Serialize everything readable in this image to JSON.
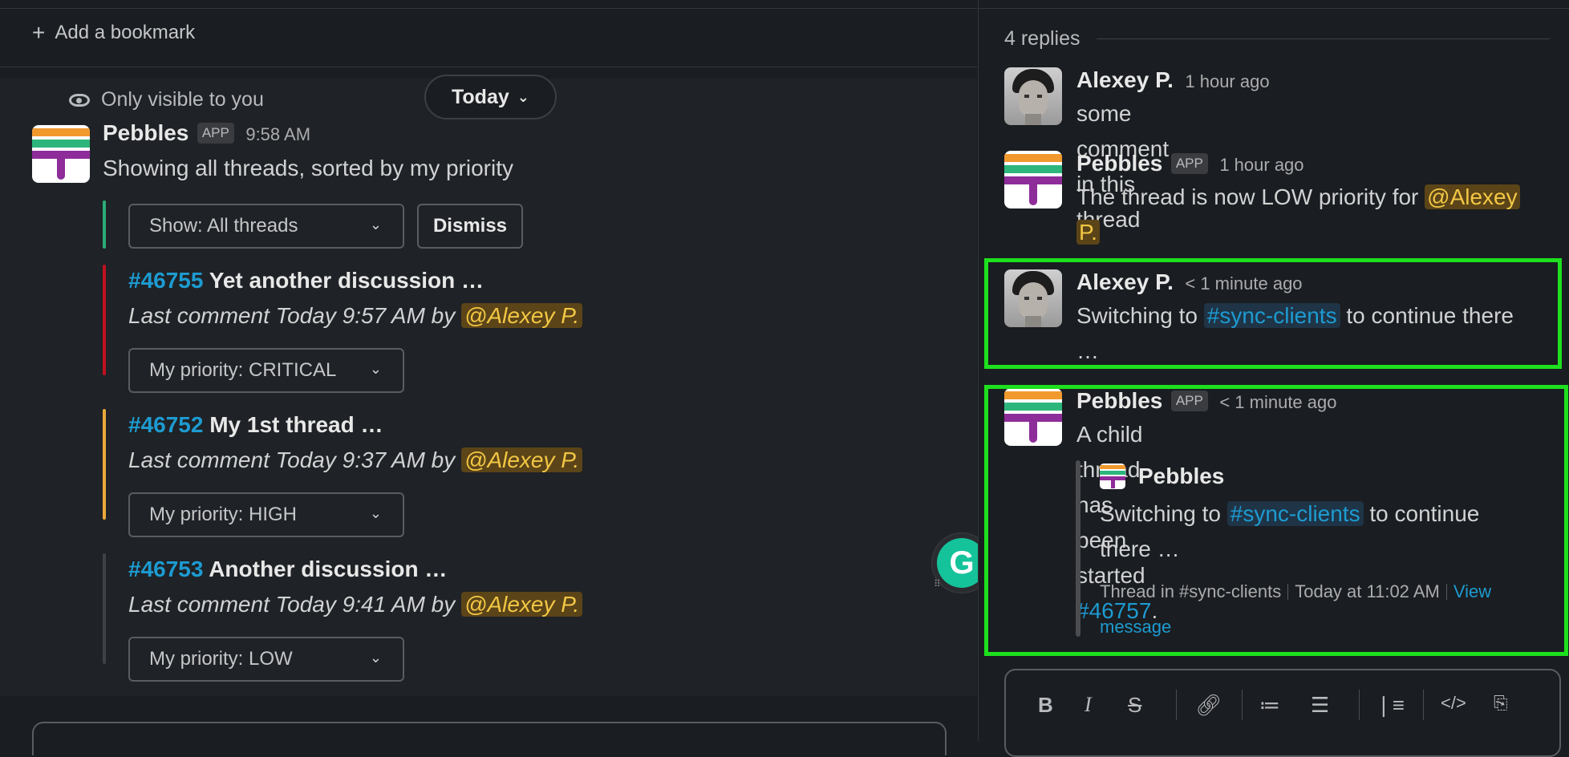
{
  "bookmark": {
    "label": "Add a bookmark"
  },
  "channel_view": {
    "only_visible": "Only visible to you",
    "today_pill": "Today",
    "message": {
      "author": "Pebbles",
      "badge": "APP",
      "time": "9:58 AM",
      "text": "Showing all threads, sorted by my priority"
    },
    "filter_select": "Show: All threads",
    "dismiss": "Dismiss",
    "threads": [
      {
        "num": "#46755",
        "title": "Yet another discussion …",
        "last_comment": "Last comment Today 9:57 AM by",
        "mention": "@Alexey P.",
        "priority": "My priority: CRITICAL",
        "color": "#c0111f"
      },
      {
        "num": "#46752",
        "title": "My 1st thread …",
        "last_comment": "Last comment Today 9:37 AM by",
        "mention": "@Alexey P.",
        "priority": "My priority: HIGH",
        "color": "#e8a93b"
      },
      {
        "num": "#46753",
        "title": "Another discussion …",
        "last_comment": "Last comment Today 9:41 AM by",
        "mention": "@Alexey P.",
        "priority": "My priority: LOW",
        "color": "#3f4146"
      }
    ]
  },
  "thread_panel": {
    "replies": "4 replies",
    "messages": [
      {
        "author": "Alexey P.",
        "time": "1 hour ago",
        "text": "some comment in this thread"
      },
      {
        "author": "Pebbles",
        "badge": "APP",
        "time": "1 hour ago",
        "text_before": "The thread is now LOW priority for ",
        "mention_line1": "@Alexey",
        "mention_line2": "P."
      },
      {
        "author": "Alexey P.",
        "time": "< 1 minute ago",
        "text_before": "Switching to ",
        "channel": "#sync-clients",
        "text_after": " to continue there",
        "text_line2": "…"
      },
      {
        "author": "Pebbles",
        "badge": "APP",
        "time": "< 1 minute ago",
        "text_before": "A child thread has been started ",
        "link": "#46757",
        "text_after": "."
      }
    ],
    "quoted": {
      "author": "Pebbles",
      "text_before": "Switching to ",
      "channel": "#sync-clients",
      "text_after": " to continue",
      "text_line2": "there …",
      "footer_channel": "Thread in #sync-clients",
      "footer_time": "Today at 11:02 AM",
      "footer_link1": "View",
      "footer_link2": "message"
    },
    "toolbar": {
      "bold": "B",
      "italic": "I",
      "strike": "S"
    }
  },
  "colors": {
    "highlight": "#1ee01e",
    "link": "#1d9bd1",
    "mention_bg": "#5b4418",
    "mention_fg": "#f2c744"
  }
}
